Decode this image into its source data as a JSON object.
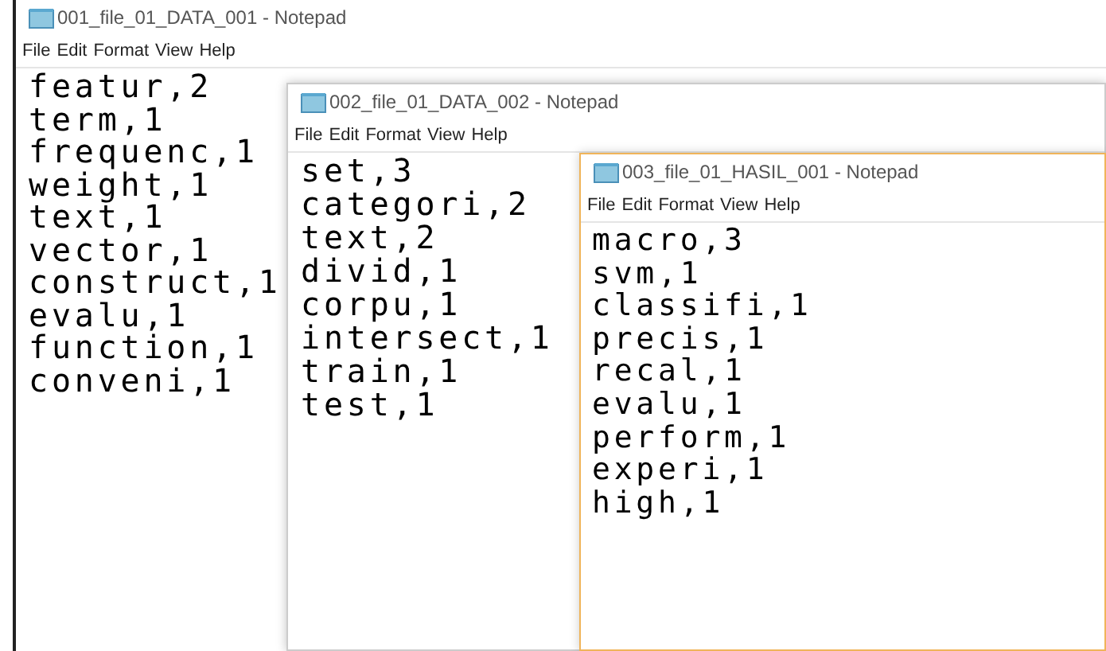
{
  "windows": [
    {
      "title": "001_file_01_DATA_001 - Notepad",
      "menu": [
        "File",
        "Edit",
        "Format",
        "View",
        "Help"
      ],
      "lines": [
        "featur,2",
        "term,1",
        "frequenc,1",
        "weight,1",
        "text,1",
        "vector,1",
        "construct,1",
        "evalu,1",
        "function,1",
        "conveni,1"
      ]
    },
    {
      "title": "002_file_01_DATA_002 - Notepad",
      "menu": [
        "File",
        "Edit",
        "Format",
        "View",
        "Help"
      ],
      "lines": [
        "set,3",
        "categori,2",
        "text,2",
        "divid,1",
        "corpu,1",
        "intersect,1",
        "train,1",
        "test,1"
      ]
    },
    {
      "title": "003_file_01_HASIL_001 - Notepad",
      "menu": [
        "File",
        "Edit",
        "Format",
        "View",
        "Help"
      ],
      "lines": [
        "macro,3",
        "svm,1",
        "classifi,1",
        "precis,1",
        "recal,1",
        "evalu,1",
        "perform,1",
        "experi,1",
        "high,1"
      ]
    }
  ]
}
